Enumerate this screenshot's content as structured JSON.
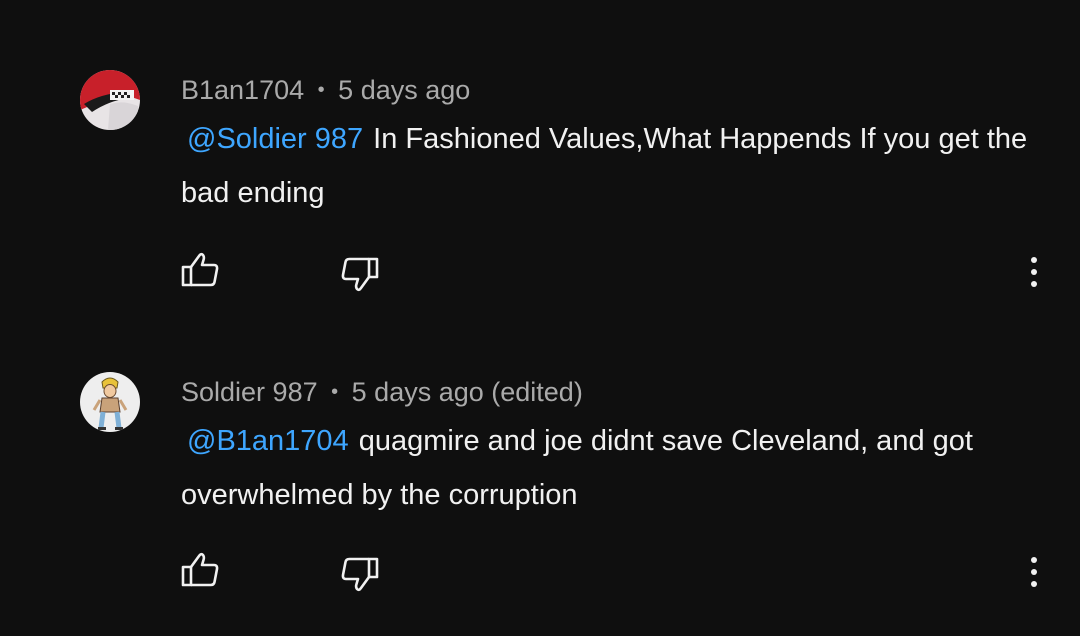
{
  "comments": [
    {
      "author": "B1an1704",
      "separator": "•",
      "time": "5 days ago",
      "mention": "@Soldier 987",
      "text": "In Fashioned Values,What Happends If you get the bad ending",
      "avatar_icon": "red-helmet-avatar",
      "like_icon": "thumbs-up-icon",
      "dislike_icon": "thumbs-down-icon",
      "more_icon": "more-vertical-icon"
    },
    {
      "author": "Soldier 987",
      "separator": "•",
      "time": "5 days ago (edited)",
      "mention": "@B1an1704",
      "text": "quagmire and joe didnt save Cleveland, and got overwhelmed by the corruption",
      "avatar_icon": "cartoon-character-avatar",
      "like_icon": "thumbs-up-icon",
      "dislike_icon": "thumbs-down-icon",
      "more_icon": "more-vertical-icon"
    }
  ],
  "colors": {
    "background": "#0f0f0f",
    "mention": "#3ea6ff",
    "meta": "#aaaaaa",
    "text": "#f1f1f1"
  }
}
